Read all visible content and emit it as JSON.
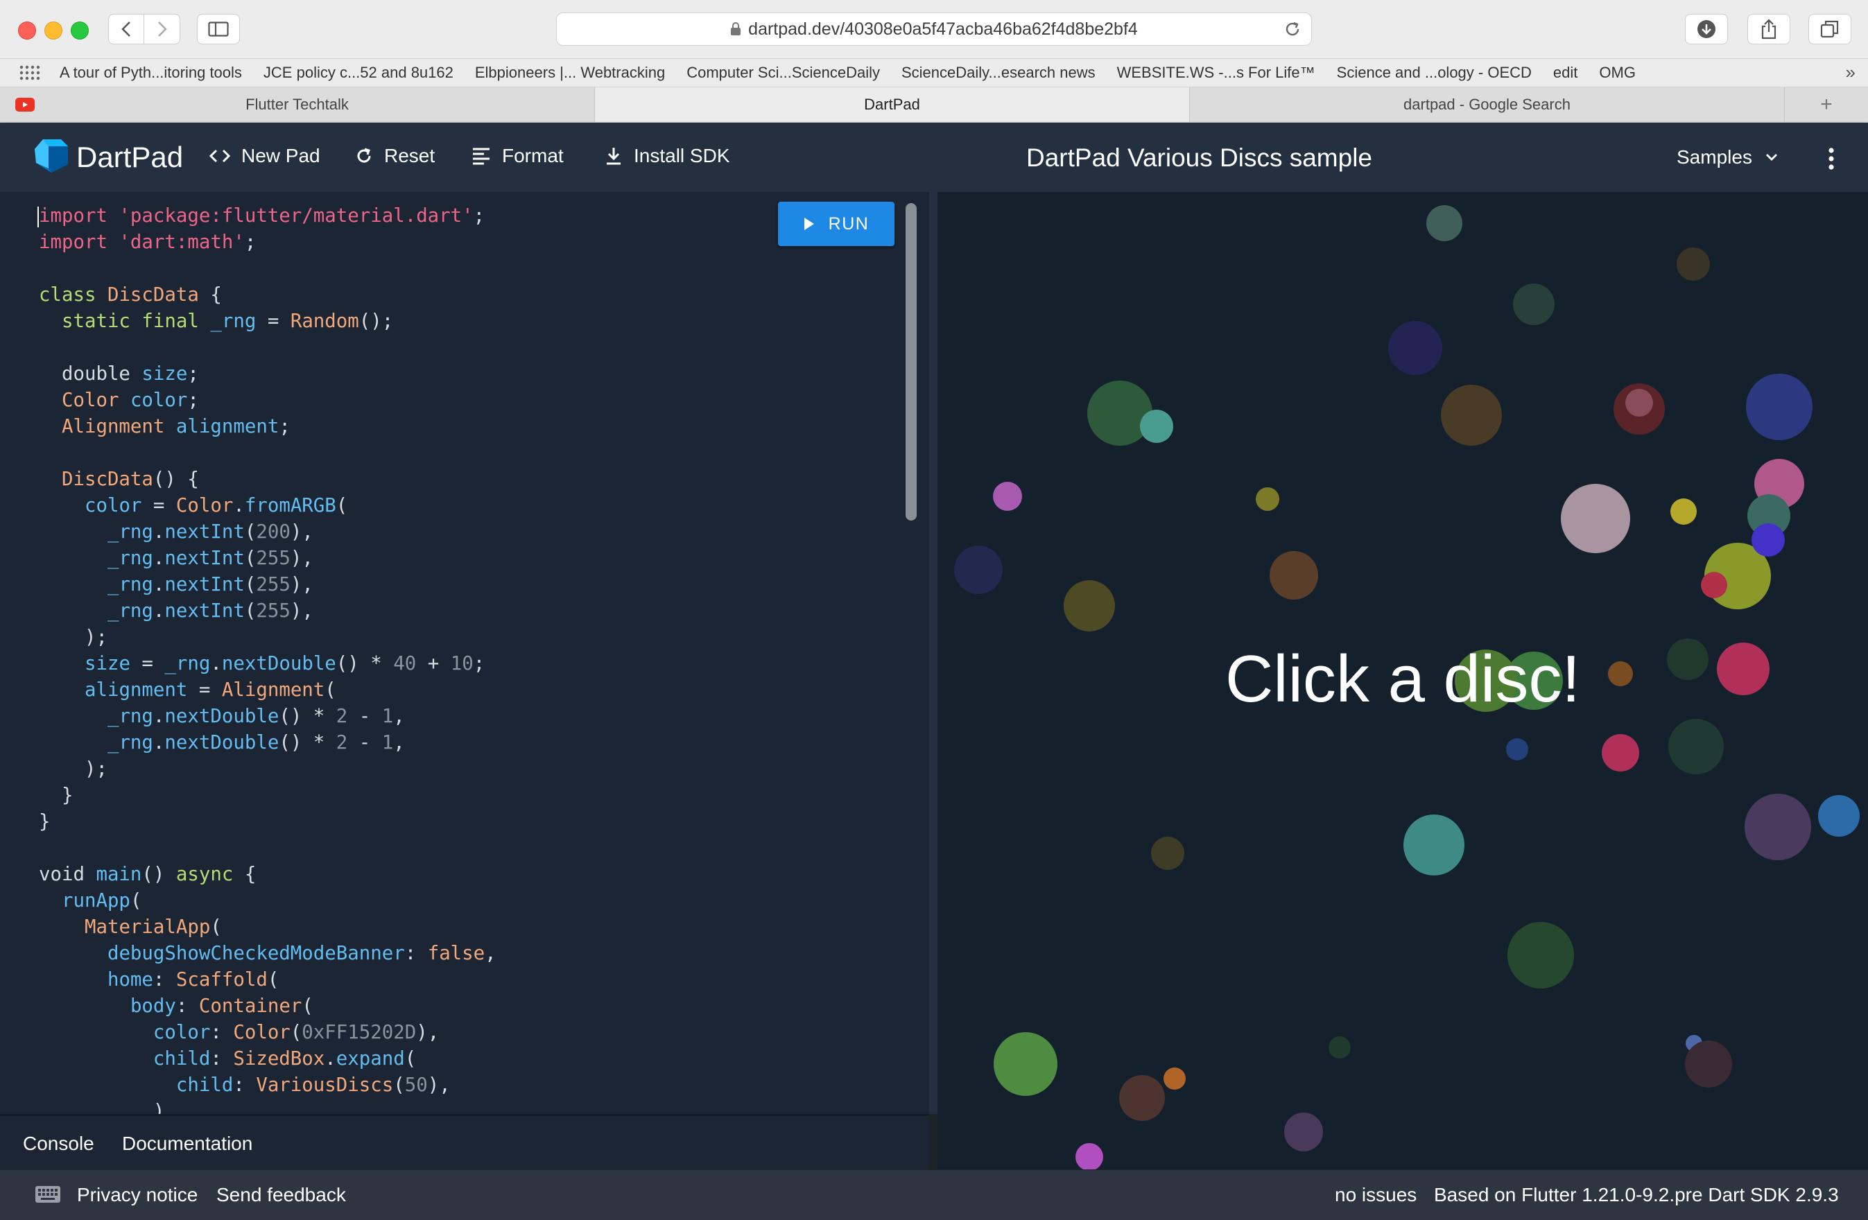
{
  "browser": {
    "url": "dartpad.dev/40308e0a5f47acba46ba62f4d8be2bf4",
    "bookmarks": [
      "A tour of Pyth...itoring tools",
      "JCE policy c...52 and 8u162",
      "Elbpioneers |... Webtracking",
      "Computer Sci...ScienceDaily",
      "ScienceDaily...esearch news",
      "WEBSITE.WS -...s For Life™",
      "Science and ...ology - OECD",
      "edit",
      "OMG"
    ],
    "tabs": [
      "Flutter Techtalk",
      "DartPad",
      "dartpad - Google Search"
    ],
    "active_tab": "DartPad"
  },
  "header": {
    "brand": "DartPad",
    "new_pad": "New Pad",
    "reset": "Reset",
    "format": "Format",
    "install_sdk": "Install SDK",
    "title": "DartPad Various Discs sample",
    "samples": "Samples"
  },
  "editor": {
    "run_label": "RUN",
    "code_lines": [
      [
        [
          "s",
          "import 'package:flutter/material.dart'"
        ],
        [
          "p",
          ";"
        ]
      ],
      [
        [
          "s",
          "import 'dart:math'"
        ],
        [
          "p",
          ";"
        ]
      ],
      [],
      [
        [
          "k",
          "class "
        ],
        [
          "t",
          "DiscData"
        ],
        [
          "p",
          " {"
        ]
      ],
      [
        [
          "p",
          "  "
        ],
        [
          "k",
          "static final "
        ],
        [
          "f",
          "_rng"
        ],
        [
          "p",
          " = "
        ],
        [
          "t",
          "Random"
        ],
        [
          "p",
          "();"
        ]
      ],
      [],
      [
        [
          "p",
          "  double "
        ],
        [
          "f",
          "size"
        ],
        [
          "p",
          ";"
        ]
      ],
      [
        [
          "p",
          "  "
        ],
        [
          "t",
          "Color "
        ],
        [
          "f",
          "color"
        ],
        [
          "p",
          ";"
        ]
      ],
      [
        [
          "p",
          "  "
        ],
        [
          "t",
          "Alignment "
        ],
        [
          "f",
          "alignment"
        ],
        [
          "p",
          ";"
        ]
      ],
      [],
      [
        [
          "p",
          "  "
        ],
        [
          "t",
          "DiscData"
        ],
        [
          "p",
          "() {"
        ]
      ],
      [
        [
          "p",
          "    "
        ],
        [
          "f",
          "color"
        ],
        [
          "p",
          " = "
        ],
        [
          "t",
          "Color"
        ],
        [
          "p",
          "."
        ],
        [
          "f",
          "fromARGB"
        ],
        [
          "p",
          "("
        ]
      ],
      [
        [
          "p",
          "      "
        ],
        [
          "f",
          "_rng"
        ],
        [
          "p",
          "."
        ],
        [
          "f",
          "nextInt"
        ],
        [
          "p",
          "("
        ],
        [
          "n",
          "200"
        ],
        [
          "p",
          "),"
        ]
      ],
      [
        [
          "p",
          "      "
        ],
        [
          "f",
          "_rng"
        ],
        [
          "p",
          "."
        ],
        [
          "f",
          "nextInt"
        ],
        [
          "p",
          "("
        ],
        [
          "n",
          "255"
        ],
        [
          "p",
          "),"
        ]
      ],
      [
        [
          "p",
          "      "
        ],
        [
          "f",
          "_rng"
        ],
        [
          "p",
          "."
        ],
        [
          "f",
          "nextInt"
        ],
        [
          "p",
          "("
        ],
        [
          "n",
          "255"
        ],
        [
          "p",
          "),"
        ]
      ],
      [
        [
          "p",
          "      "
        ],
        [
          "f",
          "_rng"
        ],
        [
          "p",
          "."
        ],
        [
          "f",
          "nextInt"
        ],
        [
          "p",
          "("
        ],
        [
          "n",
          "255"
        ],
        [
          "p",
          "),"
        ]
      ],
      [
        [
          "p",
          "    );"
        ]
      ],
      [
        [
          "p",
          "    "
        ],
        [
          "f",
          "size"
        ],
        [
          "p",
          " = "
        ],
        [
          "f",
          "_rng"
        ],
        [
          "p",
          "."
        ],
        [
          "f",
          "nextDouble"
        ],
        [
          "p",
          "() * "
        ],
        [
          "n",
          "40"
        ],
        [
          "p",
          " + "
        ],
        [
          "n",
          "10"
        ],
        [
          "p",
          ";"
        ]
      ],
      [
        [
          "p",
          "    "
        ],
        [
          "f",
          "alignment"
        ],
        [
          "p",
          " = "
        ],
        [
          "t",
          "Alignment"
        ],
        [
          "p",
          "("
        ]
      ],
      [
        [
          "p",
          "      "
        ],
        [
          "f",
          "_rng"
        ],
        [
          "p",
          "."
        ],
        [
          "f",
          "nextDouble"
        ],
        [
          "p",
          "() * "
        ],
        [
          "n",
          "2"
        ],
        [
          "p",
          " - "
        ],
        [
          "n",
          "1"
        ],
        [
          "p",
          ","
        ]
      ],
      [
        [
          "p",
          "      "
        ],
        [
          "f",
          "_rng"
        ],
        [
          "p",
          "."
        ],
        [
          "f",
          "nextDouble"
        ],
        [
          "p",
          "() * "
        ],
        [
          "n",
          "2"
        ],
        [
          "p",
          " - "
        ],
        [
          "n",
          "1"
        ],
        [
          "p",
          ","
        ]
      ],
      [
        [
          "p",
          "    );"
        ]
      ],
      [
        [
          "p",
          "  }"
        ]
      ],
      [
        [
          "p",
          "}"
        ]
      ],
      [],
      [
        [
          "p",
          "void "
        ],
        [
          "f",
          "main"
        ],
        [
          "p",
          "() "
        ],
        [
          "k",
          "async"
        ],
        [
          "p",
          " {"
        ]
      ],
      [
        [
          "p",
          "  "
        ],
        [
          "f",
          "runApp"
        ],
        [
          "p",
          "("
        ]
      ],
      [
        [
          "p",
          "    "
        ],
        [
          "t",
          "MaterialApp"
        ],
        [
          "p",
          "("
        ]
      ],
      [
        [
          "p",
          "      "
        ],
        [
          "f",
          "debugShowCheckedModeBanner"
        ],
        [
          "p",
          ": "
        ],
        [
          "t",
          "false"
        ],
        [
          "p",
          ","
        ]
      ],
      [
        [
          "p",
          "      "
        ],
        [
          "f",
          "home"
        ],
        [
          "p",
          ": "
        ],
        [
          "t",
          "Scaffold"
        ],
        [
          "p",
          "("
        ]
      ],
      [
        [
          "p",
          "        "
        ],
        [
          "f",
          "body"
        ],
        [
          "p",
          ": "
        ],
        [
          "t",
          "Container"
        ],
        [
          "p",
          "("
        ]
      ],
      [
        [
          "p",
          "          "
        ],
        [
          "f",
          "color"
        ],
        [
          "p",
          ": "
        ],
        [
          "t",
          "Color"
        ],
        [
          "p",
          "("
        ],
        [
          "n",
          "0xFF15202D"
        ],
        [
          "p",
          "),"
        ]
      ],
      [
        [
          "p",
          "          "
        ],
        [
          "f",
          "child"
        ],
        [
          "p",
          ": "
        ],
        [
          "t",
          "SizedBox"
        ],
        [
          "p",
          "."
        ],
        [
          "f",
          "expand"
        ],
        [
          "p",
          "("
        ]
      ],
      [
        [
          "p",
          "            "
        ],
        [
          "f",
          "child"
        ],
        [
          "p",
          ": "
        ],
        [
          "t",
          "VariousDiscs"
        ],
        [
          "p",
          "("
        ],
        [
          "n",
          "50"
        ],
        [
          "p",
          "),"
        ]
      ],
      [
        [
          "p",
          "          ),"
        ]
      ]
    ]
  },
  "output": {
    "text": "Click a disc!",
    "background": "#15202D"
  },
  "console": {
    "tabs": [
      "Console",
      "Documentation"
    ]
  },
  "footer": {
    "privacy": "Privacy notice",
    "feedback": "Send feedback",
    "issues": "no issues",
    "sdk": "Based on Flutter 1.21.0-9.2.pre Dart SDK 2.9.3"
  },
  "colors": {
    "run_button": "#1E88E5",
    "header_bg": "#243040",
    "editor_bg": "#1B2533"
  }
}
